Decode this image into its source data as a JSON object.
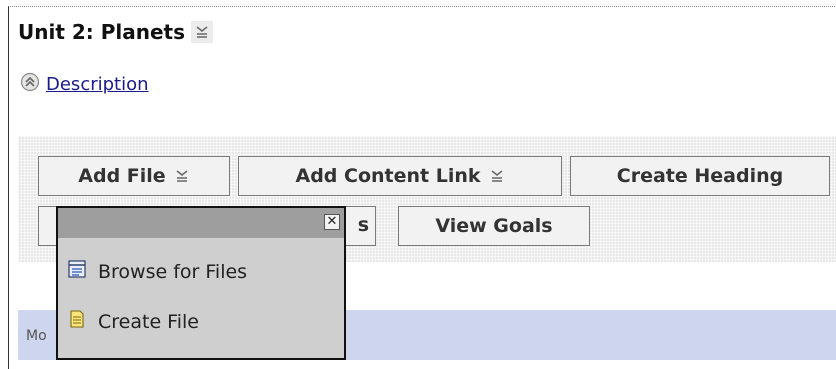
{
  "unit": {
    "title": "Unit 2: Planets",
    "description_label": "Description"
  },
  "toolbar": {
    "add_file_label": "Add File",
    "add_content_link_label": "Add Content Link",
    "create_heading_label": "Create Heading",
    "hidden_button_text": "s",
    "view_goals_label": "View Goals"
  },
  "add_file_menu": {
    "close_label": "✕",
    "items": [
      {
        "label": "Browse for Files",
        "icon": "browse-files-icon"
      },
      {
        "label": "Create File",
        "icon": "create-file-icon"
      }
    ]
  },
  "content_table": {
    "header_label": "Mo"
  },
  "colors": {
    "link": "#1a1a8c",
    "table_header": "#cdd6ee",
    "popup_bg": "#cfcfcf",
    "popup_bar": "#9e9e9e"
  }
}
